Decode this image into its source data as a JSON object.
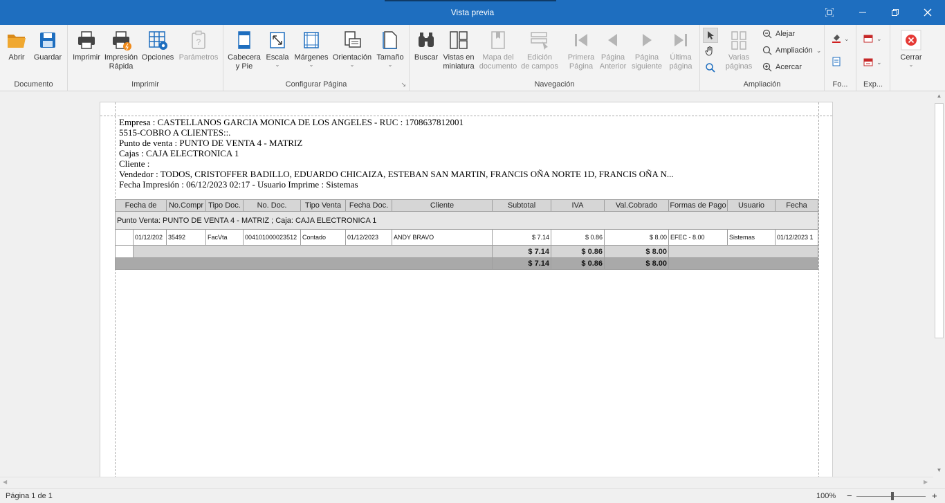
{
  "window": {
    "title": "Vista previa",
    "accent": "#1e6ebf"
  },
  "ribbon": {
    "groups": {
      "documento": "Documento",
      "imprimir": "Imprimir",
      "configurar": "Configurar Página",
      "navegacion": "Navegación",
      "ampliacion": "Ampliación",
      "fondo": "Fo...",
      "exportar": "Exp..."
    },
    "buttons": {
      "abrir": "Abrir",
      "guardar": "Guardar",
      "imprimir": "Imprimir",
      "impresion_rapida_1": "Impresión",
      "impresion_rapida_2": "Rápida",
      "opciones": "Opciones",
      "parametros": "Parámetros",
      "cabecera_1": "Cabecera",
      "cabecera_2": "y Pie",
      "escala": "Escala",
      "margenes": "Márgenes",
      "orientacion": "Orientación",
      "tamano": "Tamaño",
      "buscar": "Buscar",
      "vistas_1": "Vistas en",
      "vistas_2": "miniatura",
      "mapa_1": "Mapa del",
      "mapa_2": "documento",
      "edicion_1": "Edición",
      "edicion_2": "de campos",
      "primera_1": "Primera",
      "primera_2": "Página",
      "anterior_1": "Página",
      "anterior_2": "Anterior",
      "siguiente_1": "Página",
      "siguiente_2": "siguiente",
      "ultima_1": "Última",
      "ultima_2": "página",
      "varias_1": "Varias",
      "varias_2": "páginas",
      "alejar": "Alejar",
      "ampliacion": "Ampliación",
      "acercar": "Acercar",
      "cerrar": "Cerrar"
    }
  },
  "report": {
    "header_lines": [
      "Empresa : CASTELLANOS GARCIA MONICA DE LOS ANGELES  -  RUC : 1708637812001",
      "5515-COBRO A CLIENTES::.",
      "Punto de venta : PUNTO DE VENTA 4 - MATRIZ",
      "Cajas : CAJA ELECTRONICA 1",
      "Cliente :",
      "Vendedor :  TODOS, CRISTOFFER BADILLO, EDUARDO CHICAIZA, ESTEBAN SAN MARTIN, FRANCIS OÑA NORTE 1D, FRANCIS OÑA N...",
      "Fecha Impresión : 06/12/2023 02:17  -  Usuario Imprime : Sistemas"
    ],
    "columns": [
      "Fecha de",
      "No.Compr",
      "Tipo Doc.",
      "No. Doc.",
      "Tipo Venta",
      "Fecha Doc.",
      "Cliente",
      "Subtotal",
      "IVA",
      "Val.Cobrado",
      "Formas de Pago",
      "Usuario",
      "Fecha"
    ],
    "group_label": "Punto Venta: PUNTO DE VENTA 4 - MATRIZ ; Caja: CAJA ELECTRONICA 1",
    "rows": [
      [
        "01/12/202",
        "35492",
        "FacVta",
        "004101000023512",
        "Contado",
        "01/12/2023",
        "ANDY BRAVO",
        "$ 7.14",
        "$ 0.86",
        "$ 8.00",
        "EFEC - 8.00",
        "Sistemas",
        "01/12/2023 1"
      ]
    ],
    "subtotal": {
      "subtotal": "$ 7.14",
      "iva": "$ 0.86",
      "cobrado": "$ 8.00"
    },
    "total": {
      "subtotal": "$ 7.14",
      "iva": "$ 0.86",
      "cobrado": "$ 8.00"
    }
  },
  "status": {
    "page": "Página 1 de 1",
    "zoom": "100%",
    "zoom_minus": "−",
    "zoom_plus": "+"
  }
}
